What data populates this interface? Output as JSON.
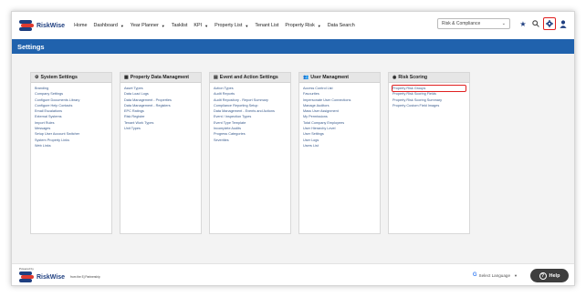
{
  "brand": {
    "name": "RiskWise"
  },
  "nav": {
    "items": [
      {
        "label": "Home",
        "dropdown": false
      },
      {
        "label": "Dashboard",
        "dropdown": true
      },
      {
        "label": "Year Planner",
        "dropdown": true
      },
      {
        "label": "Tasklist",
        "dropdown": false
      },
      {
        "label": "KPI",
        "dropdown": true
      },
      {
        "label": "Property List",
        "dropdown": true
      },
      {
        "label": "Tenant List",
        "dropdown": false
      },
      {
        "label": "Property Risk",
        "dropdown": true
      },
      {
        "label": "Data Search",
        "dropdown": false
      }
    ],
    "module_select": "Risk & Compliance"
  },
  "page": {
    "title": "Settings"
  },
  "panels": [
    {
      "title": "System Settings",
      "icon": "gear-icon",
      "links": [
        "Branding",
        "Company Settings",
        "Configure Documents Library",
        "Configure Help Contacts",
        "Email Escalations",
        "External Systems",
        "Import Rules",
        "Messages",
        "Setup User Account Switcher",
        "System Property Links",
        "Web Links"
      ]
    },
    {
      "title": "Property Data Managment",
      "icon": "building-icon",
      "links": [
        "Asset Types",
        "Data Load Logs",
        "Data Management - Properties",
        "Data Management - Registers",
        "EPC Ratings",
        "Risk Register",
        "Tenant Work Types",
        "Unit Types"
      ]
    },
    {
      "title": "Event and Action Settings",
      "icon": "calendar-icon",
      "links": [
        "Action Types",
        "Audit Reports",
        "Audit Repository - Report Summary",
        "Compliance Reporting Setup",
        "Data Management - Events and Actions",
        "Event / Inspection Types",
        "Event Type Template",
        "Incomplete Audits",
        "Progress Categories",
        "Severities"
      ]
    },
    {
      "title": "User Managment",
      "icon": "users-icon",
      "links": [
        "Access Control List",
        "Favourites",
        "Impersonate User Connections",
        "Manage Auditors",
        "Mass User Assignment",
        "My Permissions",
        "Total Company Employees",
        "User Hierarchy Level",
        "User Settings",
        "User Logs",
        "Users List"
      ]
    },
    {
      "title": "Risk Scoring",
      "icon": "dashboard-icon",
      "links": [
        "Property Risk Groups",
        "Property Risk Scoring Fields",
        "Property Risk Scoring Summary",
        "Property Custom Field Images"
      ],
      "highlighted_link": "Property Risk Groups"
    }
  ],
  "footer": {
    "powered_by": "Powered by",
    "brand": "RiskWise",
    "partner": "from the Ej Partnership",
    "translate": "Select Language",
    "help": "Help"
  }
}
